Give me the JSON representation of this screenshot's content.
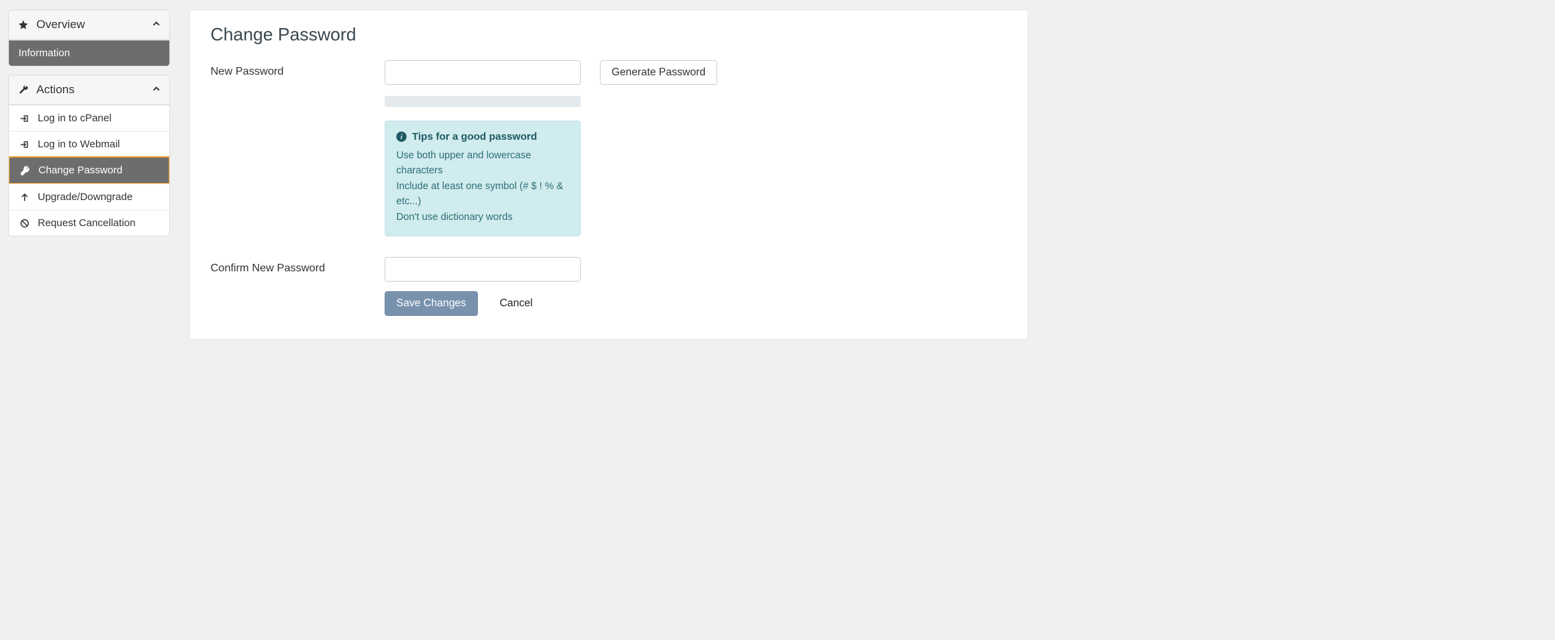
{
  "sidebar": {
    "overview": {
      "title": "Overview",
      "items": [
        {
          "label": "Information"
        }
      ]
    },
    "actions": {
      "title": "Actions",
      "items": [
        {
          "label": "Log in to cPanel"
        },
        {
          "label": "Log in to Webmail"
        },
        {
          "label": "Change Password"
        },
        {
          "label": "Upgrade/Downgrade"
        },
        {
          "label": "Request Cancellation"
        }
      ]
    }
  },
  "main": {
    "title": "Change Password",
    "new_password_label": "New Password",
    "confirm_label": "Confirm New Password",
    "generate_label": "Generate Password",
    "save_label": "Save Changes",
    "cancel_label": "Cancel",
    "new_password_value": "",
    "confirm_value": "",
    "tips": {
      "heading": "Tips for a good password",
      "line1": "Use both upper and lowercase characters",
      "line2": "Include at least one symbol (# $ ! % & etc...)",
      "line3": "Don't use dictionary words"
    }
  }
}
